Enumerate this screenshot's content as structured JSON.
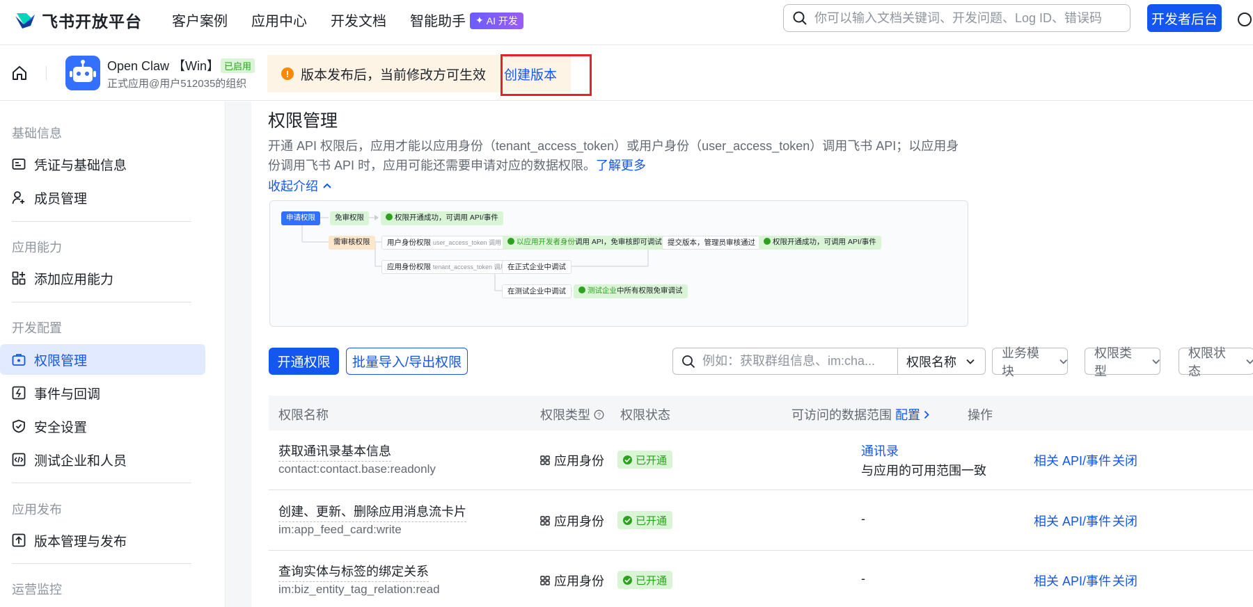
{
  "topnav": {
    "logo_text": "飞书开放平台",
    "links": [
      "客户案例",
      "应用中心",
      "开发文档",
      "智能助手"
    ],
    "ai_badge": "AI 开发",
    "search_placeholder": "你可以输入文档关键词、开发问题、Log ID、错误码",
    "dev_button": "开发者后台"
  },
  "appbar": {
    "app_name": "Open Claw 【Win】",
    "enabled_badge": "已启用",
    "org": "正式应用@用户512035的组织",
    "notice": "版本发布后，当前修改方可生效",
    "create_version": "创建版本"
  },
  "sidebar": {
    "groups": [
      "基础信息",
      "应用能力",
      "开发配置",
      "应用发布",
      "运营监控"
    ],
    "items": [
      {
        "label": "凭证与基础信息",
        "icon": "id-card-icon"
      },
      {
        "label": "成员管理",
        "icon": "add-user-icon"
      },
      {
        "label": "添加应用能力",
        "icon": "grid-plus-icon"
      },
      {
        "label": "权限管理",
        "icon": "permission-lock-icon",
        "active": true
      },
      {
        "label": "事件与回调",
        "icon": "event-icon"
      },
      {
        "label": "安全设置",
        "icon": "shield-icon"
      },
      {
        "label": "测试企业和人员",
        "icon": "code-icon"
      },
      {
        "label": "版本管理与发布",
        "icon": "upload-icon"
      }
    ]
  },
  "main": {
    "title": "权限管理",
    "desc": "开通 API 权限后，应用才能以应用身份（tenant_access_token）或用户身份（user_access_token）调用飞书 API；以应用身份调用飞书 API 时，应用可能还需要申请对应的数据权限。",
    "learn_more": "了解更多",
    "collapse": "收起介绍",
    "diagram": {
      "apply": "申请权限",
      "free": "免审权限",
      "free_result": "权限开通成功，可调用 API/事件",
      "review": "需审核权限",
      "user_perm": "用户身份权限",
      "user_perm_sub": "user_access_token 调用",
      "dev_call_hl": "以应用开发者身份",
      "dev_call_rest": "调用 API，免审核即可调试",
      "submit": "提交版本，管理员审核通过",
      "final_result": "权限开通成功，可调用 API/事件",
      "app_perm": "应用身份权限",
      "app_perm_sub": "tenant_access_token 调用",
      "prod_debug": "在正式企业中调试",
      "test_debug": "在测试企业中调试",
      "test_free_hl": "测试企业",
      "test_free_rest": "中所有权限免审调试"
    },
    "btn_enable": "开通权限",
    "btn_batch": "批量导入/导出权限",
    "filter_placeholder": "例如：获取群组信息、im:cha...",
    "filter_field": "权限名称",
    "dropdowns": [
      "业务模块",
      "权限类型",
      "权限状态"
    ]
  },
  "table": {
    "headers": {
      "name": "权限名称",
      "type": "权限类型",
      "status": "权限状态",
      "data_scope": "可访问的数据范围",
      "config": "配置",
      "actions": "操作"
    },
    "rows": [
      {
        "name": "获取通讯录基本信息",
        "scope": "contact:contact.base:readonly",
        "type": "应用身份",
        "status": "已开通",
        "data_link": "通讯录",
        "data_text": "与应用的可用范围一致",
        "op1": "相关 API/事件",
        "op2": "关闭"
      },
      {
        "name": "创建、更新、删除应用消息流卡片",
        "scope": "im:app_feed_card:write",
        "type": "应用身份",
        "status": "已开通",
        "data_dash": "-",
        "op1": "相关 API/事件",
        "op2": "关闭"
      },
      {
        "name": "查询实体与标签的绑定关系",
        "scope": "im:biz_entity_tag_relation:read",
        "type": "应用身份",
        "status": "已开通",
        "data_dash": "-",
        "op1": "相关 API/事件",
        "op2": "关闭"
      }
    ]
  }
}
